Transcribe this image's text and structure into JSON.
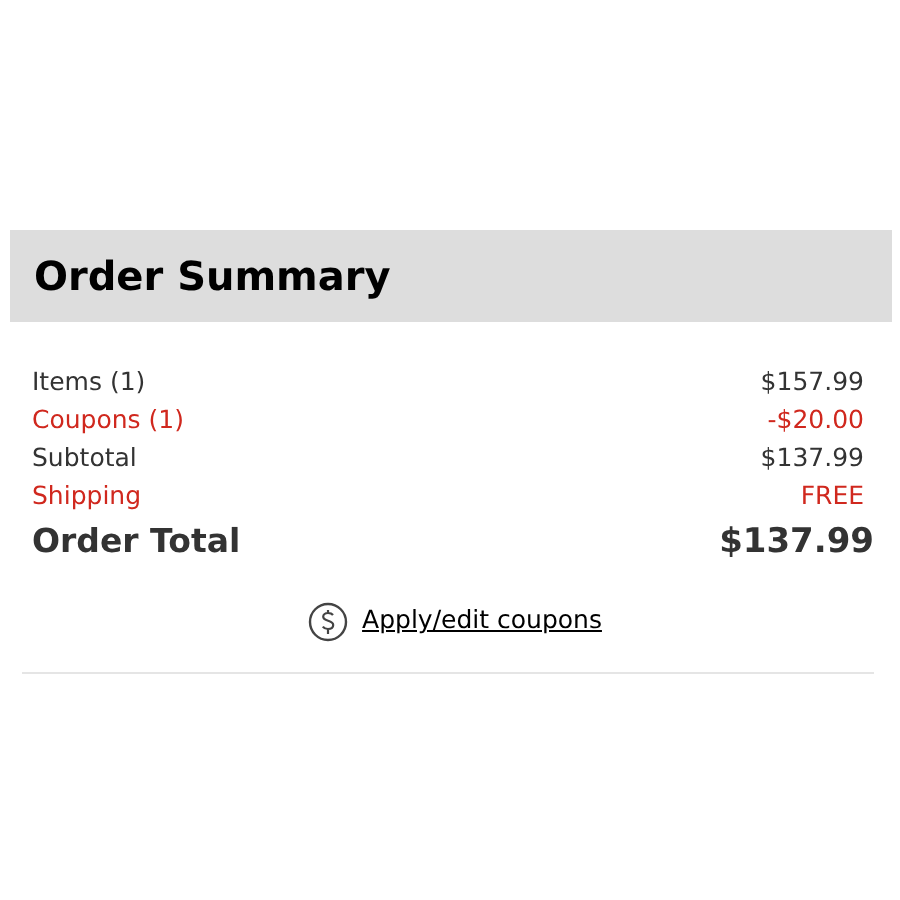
{
  "title": "Order Summary",
  "lines": [
    {
      "label": "Items (1)",
      "value": "$157.99",
      "kind": "normal"
    },
    {
      "label": "Coupons (1)",
      "value": "-$20.00",
      "kind": "discount"
    },
    {
      "label": "Subtotal",
      "value": "$137.99",
      "kind": "normal"
    },
    {
      "label": "Shipping",
      "value": "FREE",
      "kind": "discount"
    }
  ],
  "total": {
    "label": "Order Total",
    "value": "$137.99"
  },
  "coupon_link": "Apply/edit coupons"
}
